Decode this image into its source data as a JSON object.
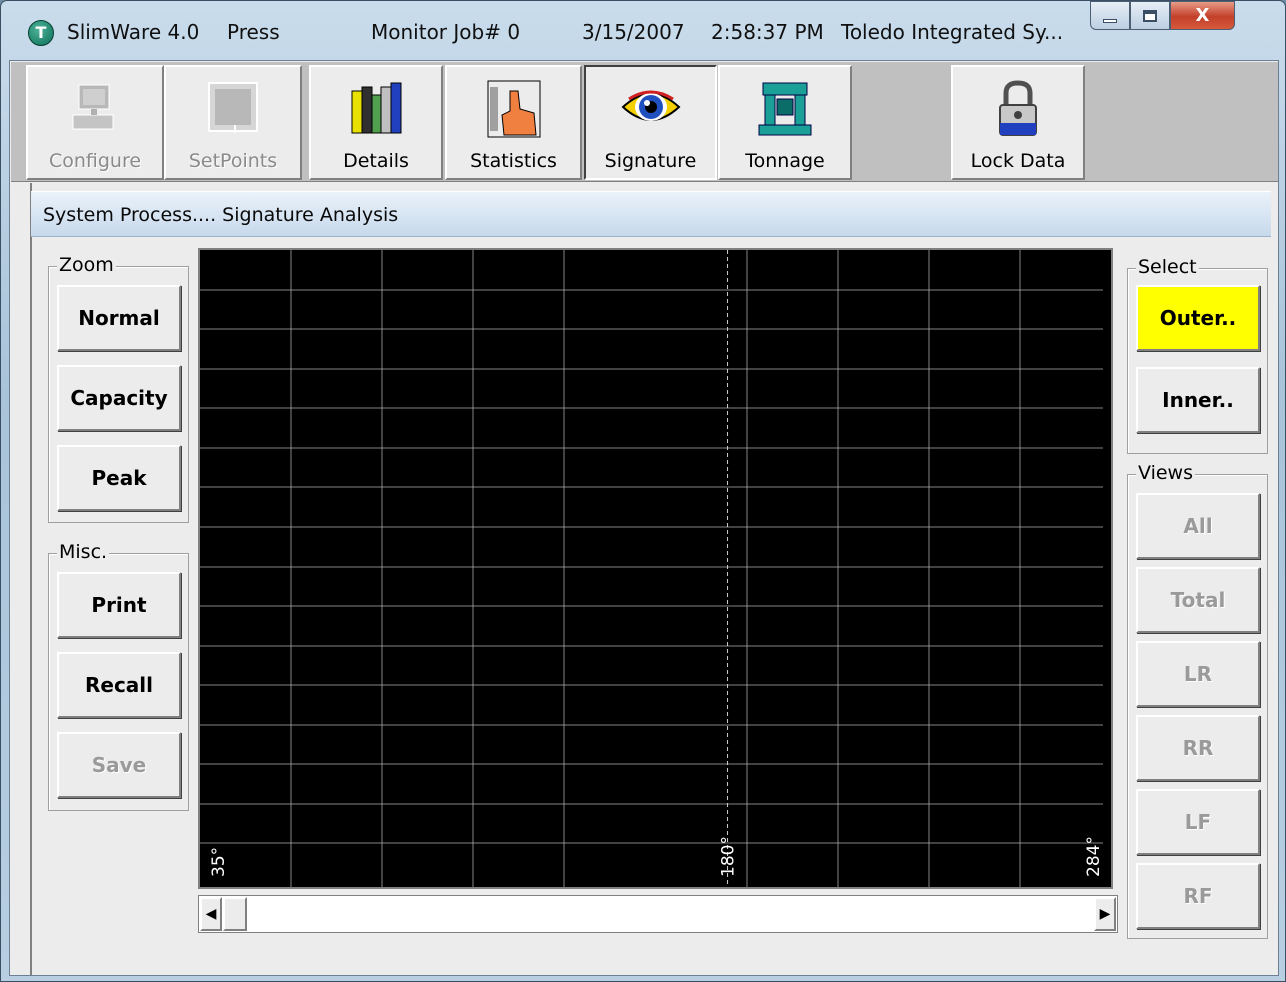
{
  "window": {
    "title_app": "SlimWare 4.0",
    "title_mode": "Press",
    "title_job": "Monitor Job# 0",
    "title_date": "3/15/2007",
    "title_time": "2:58:37 PM",
    "title_company": "Toledo Integrated Sy...",
    "close_glyph": "X"
  },
  "toolbar": {
    "configure_label": "Configure",
    "setpoints_label": "SetPoints",
    "details_label": "Details",
    "statistics_label": "Statistics",
    "signature_label": "Signature",
    "tonnage_label": "Tonnage",
    "lockdata_label": "Lock Data"
  },
  "heading": "System Process.... Signature Analysis",
  "zoom": {
    "title": "Zoom",
    "normal": "Normal",
    "capacity": "Capacity",
    "peak": "Peak"
  },
  "misc": {
    "title": "Misc.",
    "print": "Print",
    "recall": "Recall",
    "save": "Save"
  },
  "select": {
    "title": "Select",
    "outer": "Outer..",
    "inner": "Inner.."
  },
  "views": {
    "title": "Views",
    "all": "All",
    "total": "Total",
    "lr": "LR",
    "rr": "RR",
    "lf": "LF",
    "rf": "RF"
  },
  "chart_data": {
    "type": "line",
    "series": [],
    "x_tick_labels": [
      "35°",
      "180°",
      "284°"
    ],
    "x_ticks": [
      35,
      180,
      284
    ],
    "xlim": [
      35,
      284
    ],
    "marker_x": 180,
    "grid": true,
    "background": "#000000"
  },
  "colors": {
    "highlight": "#ffff00",
    "grid": "#b0b0b0"
  }
}
